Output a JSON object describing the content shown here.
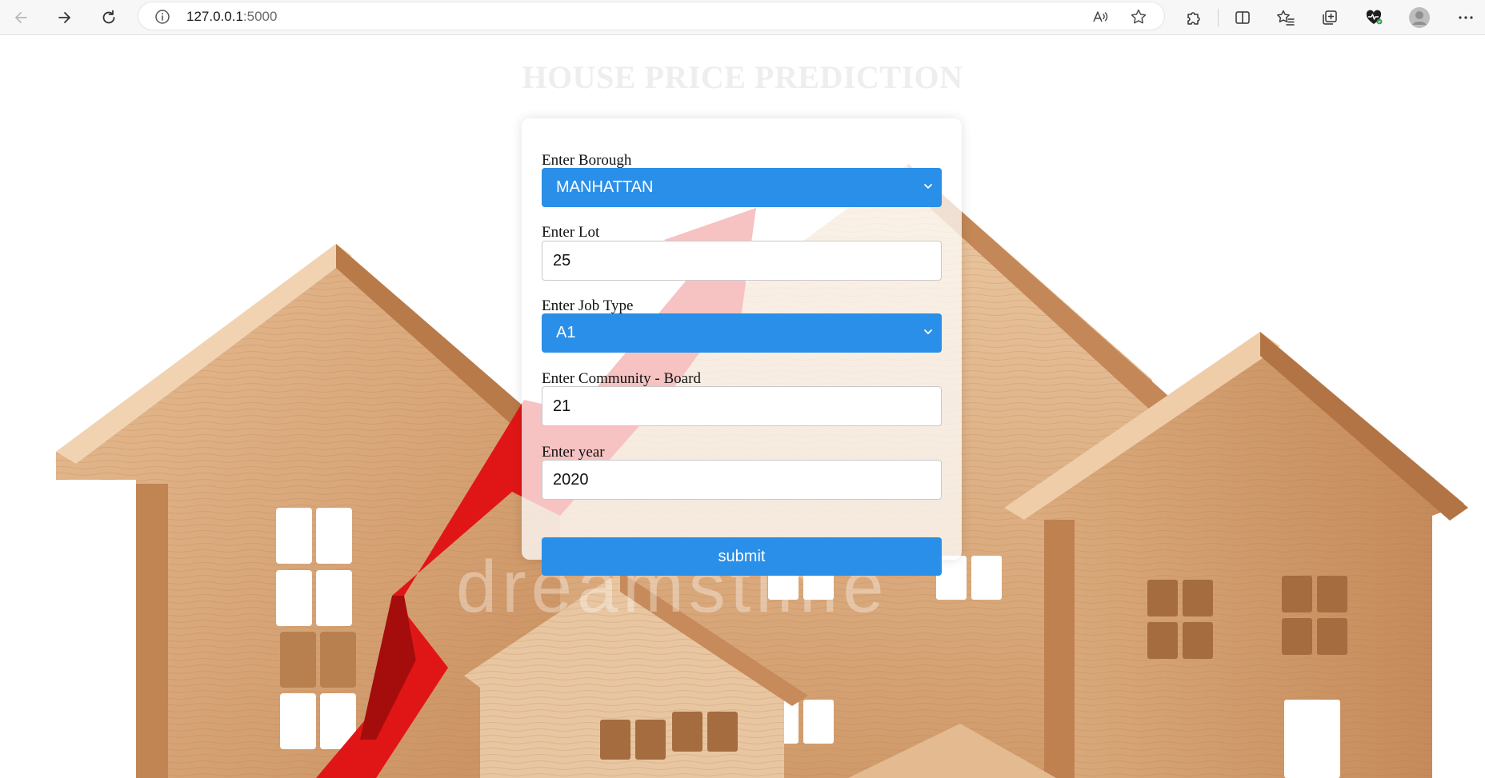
{
  "browser": {
    "url_host": "127.0.0.1",
    "url_port": ":5000",
    "icons": {
      "back": "back-arrow-icon",
      "forward": "forward-arrow-icon",
      "reload": "reload-icon",
      "site_info": "info-icon",
      "read_aloud": "read-aloud-icon",
      "favorite": "star-icon",
      "extensions": "puzzle-icon",
      "split_screen": "split-screen-icon",
      "favorites": "favorites-list-icon",
      "collections": "collections-icon",
      "browser_essentials": "heart-pulse-icon",
      "profile": "profile-avatar-icon",
      "menu": "more-menu-icon"
    }
  },
  "page": {
    "title": "HOUSE PRICE PREDICTION"
  },
  "form": {
    "borough": {
      "label": "Enter Borough",
      "value": "MANHATTAN"
    },
    "lot": {
      "label": "Enter Lot",
      "value": "25"
    },
    "job_type": {
      "label": "Enter Job Type",
      "value": "A1"
    },
    "community_board": {
      "label": "Enter Community - Board",
      "value": "21"
    },
    "year": {
      "label": "Enter year",
      "value": "2020"
    },
    "submit_label": "submit"
  },
  "colors": {
    "accent": "#2a8fe8",
    "title": "#eeeeee",
    "wood": "#d9a77a",
    "arrow": "#e01616"
  }
}
